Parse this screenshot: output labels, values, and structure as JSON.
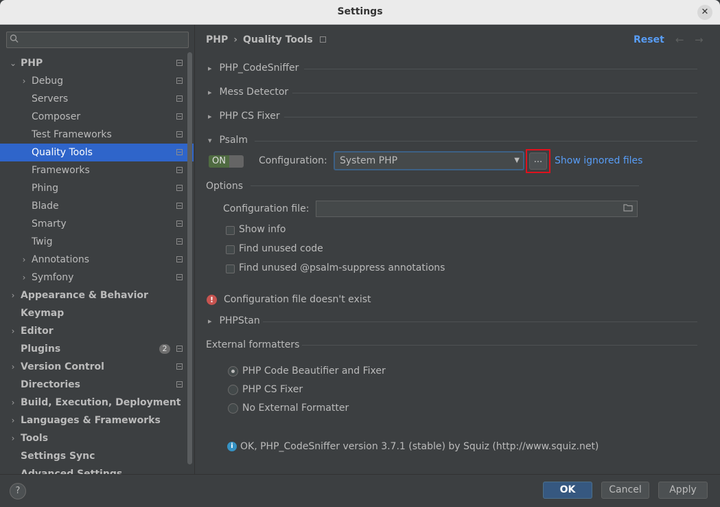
{
  "window": {
    "title": "Settings",
    "close_glyph": "✕"
  },
  "sidebar": {
    "search_icon": "search-icon",
    "items": [
      {
        "label": "PHP",
        "expanded": true
      },
      {
        "label": "Debug"
      },
      {
        "label": "Servers"
      },
      {
        "label": "Composer"
      },
      {
        "label": "Test Frameworks"
      },
      {
        "label": "Quality Tools",
        "selected": true
      },
      {
        "label": "Frameworks"
      },
      {
        "label": "Phing"
      },
      {
        "label": "Blade"
      },
      {
        "label": "Smarty"
      },
      {
        "label": "Twig"
      },
      {
        "label": "Annotations"
      },
      {
        "label": "Symfony"
      },
      {
        "label": "Appearance & Behavior"
      },
      {
        "label": "Keymap"
      },
      {
        "label": "Editor"
      },
      {
        "label": "Plugins",
        "badge": "2"
      },
      {
        "label": "Version Control"
      },
      {
        "label": "Directories"
      },
      {
        "label": "Build, Execution, Deployment"
      },
      {
        "label": "Languages & Frameworks"
      },
      {
        "label": "Tools"
      },
      {
        "label": "Settings Sync"
      },
      {
        "label": "Advanced Settings"
      }
    ]
  },
  "header": {
    "breadcrumb": [
      "PHP",
      "Quality Tools"
    ],
    "breadcrumb_sep": "›",
    "reset_label": "Reset",
    "back_glyph": "←",
    "forward_glyph": "→"
  },
  "sections": {
    "codesniffer": "PHP_CodeSniffer",
    "mess_detector": "Mess Detector",
    "cs_fixer": "PHP CS Fixer",
    "psalm": "Psalm",
    "phpstan": "PHPStan",
    "external_formatters": "External formatters"
  },
  "psalm": {
    "toggle_label": "ON",
    "configuration_label": "Configuration:",
    "configuration_value": "System PHP",
    "browse_label": "...",
    "show_ignored_link": "Show ignored files",
    "options_label": "Options",
    "config_file_label": "Configuration file:",
    "config_file_value": "",
    "checkboxes": [
      {
        "label": "Show info",
        "checked": false
      },
      {
        "label": "Find unused code",
        "checked": false
      },
      {
        "label": "Find unused @psalm-suppress annotations",
        "checked": false
      }
    ],
    "error_message": "Configuration file doesn't exist"
  },
  "formatters": {
    "options": [
      {
        "label": "PHP Code Beautifier and Fixer",
        "checked": true
      },
      {
        "label": "PHP CS Fixer",
        "checked": false
      },
      {
        "label": "No External Formatter",
        "checked": false
      }
    ]
  },
  "status": {
    "info_message": "OK, PHP_CodeSniffer version 3.7.1 (stable) by Squiz (http://www.squiz.net)"
  },
  "footer": {
    "help_label": "?",
    "ok_label": "OK",
    "cancel_label": "Cancel",
    "apply_label": "Apply"
  },
  "colors": {
    "accent": "#2f65ca",
    "link": "#589df6",
    "background": "#3c3f41",
    "highlight_border": "#e0111d",
    "error": "#c75450",
    "toggle_on": "#4f6b41"
  }
}
